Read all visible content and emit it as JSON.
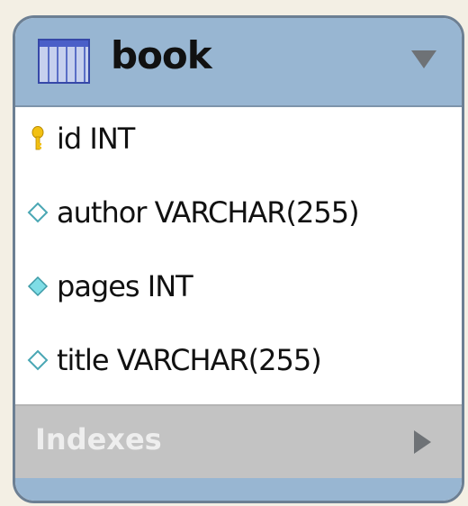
{
  "table": {
    "name": "book",
    "columns": [
      {
        "label": "id INT",
        "icon": "primary-key-icon"
      },
      {
        "label": "author VARCHAR(255)",
        "icon": "nullable-column-icon"
      },
      {
        "label": "pages INT",
        "icon": "not-null-column-icon"
      },
      {
        "label": "title VARCHAR(255)",
        "icon": "nullable-column-icon"
      }
    ],
    "indexes_label": "Indexes"
  },
  "colors": {
    "header": "#98b6d2",
    "border": "#6c7f93",
    "indexes": "#c3c3c3",
    "key": "#f2c012",
    "diamond_filled": "#7fdde6"
  }
}
